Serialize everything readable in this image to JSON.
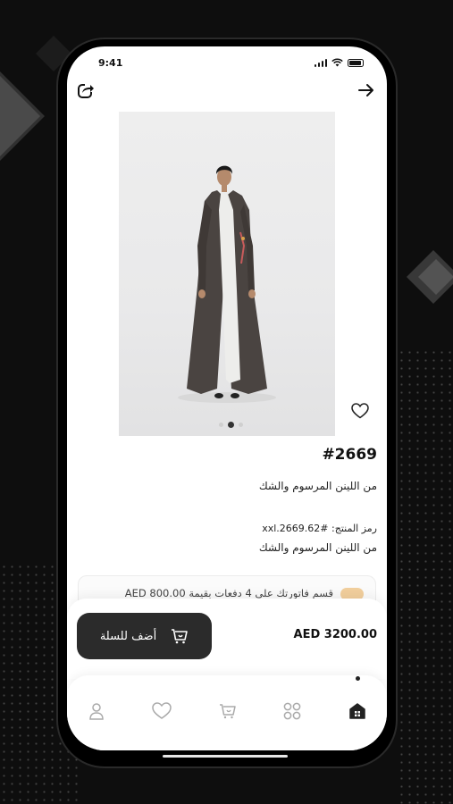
{
  "status_bar": {
    "time": "9:41"
  },
  "product": {
    "number": "#2669",
    "title": "من اللينن المرسوم والشك",
    "code_label": "رمز المنتج: #xxl.2669.62",
    "description": "من اللينن المرسوم والشك",
    "image_alt": "abaya product photo",
    "gallery_dots": 2,
    "active_dot": 1
  },
  "installment": {
    "text": "قسم فاتورتك على 4 دفعات بقيمة AED 800.00"
  },
  "cart": {
    "add_label": "أضف للسلة",
    "price": "AED 3200.00"
  },
  "nav": {
    "items": [
      "profile-icon",
      "heart-icon",
      "cart-icon",
      "categories-icon",
      "home-icon"
    ],
    "active": "home-icon"
  },
  "colors": {
    "button": "#2b2b2b",
    "screen": "#ffffff",
    "background": "#0e0e0e",
    "badge": "#f2cf9d"
  }
}
